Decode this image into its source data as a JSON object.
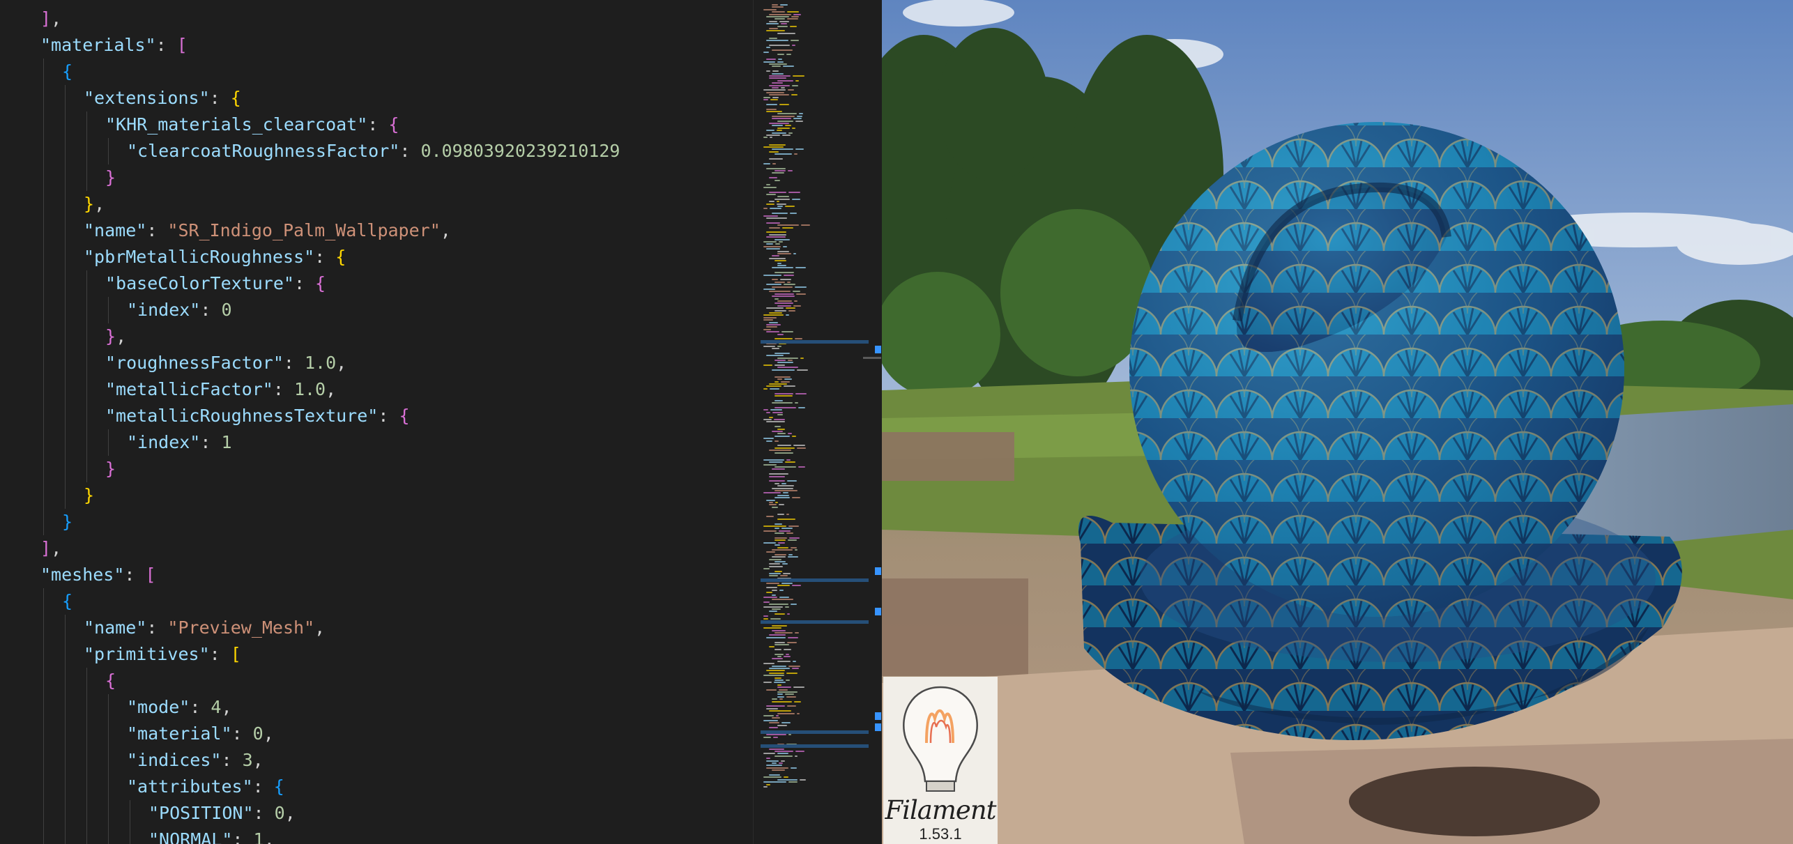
{
  "editor": {
    "lines": [
      {
        "indent": 1,
        "tokens": [
          {
            "t": "]",
            "c": "b1"
          },
          {
            "t": ",",
            "c": "p"
          }
        ]
      },
      {
        "indent": 1,
        "tokens": [
          {
            "t": "\"materials\"",
            "c": "k"
          },
          {
            "t": ": ",
            "c": "p"
          },
          {
            "t": "[",
            "c": "b1"
          }
        ]
      },
      {
        "indent": 2,
        "tokens": [
          {
            "t": "{",
            "c": "b2"
          }
        ]
      },
      {
        "indent": 3,
        "tokens": [
          {
            "t": "\"extensions\"",
            "c": "k"
          },
          {
            "t": ": ",
            "c": "p"
          },
          {
            "t": "{",
            "c": "b0"
          }
        ]
      },
      {
        "indent": 4,
        "tokens": [
          {
            "t": "\"KHR_materials_clearcoat\"",
            "c": "k"
          },
          {
            "t": ": ",
            "c": "p"
          },
          {
            "t": "{",
            "c": "b1"
          }
        ]
      },
      {
        "indent": 5,
        "tokens": [
          {
            "t": "\"clearcoatRoughnessFactor\"",
            "c": "k"
          },
          {
            "t": ": ",
            "c": "p"
          },
          {
            "t": "0.09803920239210129",
            "c": "n"
          }
        ]
      },
      {
        "indent": 4,
        "tokens": [
          {
            "t": "}",
            "c": "b1"
          }
        ]
      },
      {
        "indent": 3,
        "tokens": [
          {
            "t": "}",
            "c": "b0"
          },
          {
            "t": ",",
            "c": "p"
          }
        ]
      },
      {
        "indent": 3,
        "tokens": [
          {
            "t": "\"name\"",
            "c": "k"
          },
          {
            "t": ": ",
            "c": "p"
          },
          {
            "t": "\"SR_Indigo_Palm_Wallpaper\"",
            "c": "s"
          },
          {
            "t": ",",
            "c": "p"
          }
        ]
      },
      {
        "indent": 3,
        "tokens": [
          {
            "t": "\"pbrMetallicRoughness\"",
            "c": "k"
          },
          {
            "t": ": ",
            "c": "p"
          },
          {
            "t": "{",
            "c": "b0"
          }
        ]
      },
      {
        "indent": 4,
        "tokens": [
          {
            "t": "\"baseColorTexture\"",
            "c": "k"
          },
          {
            "t": ": ",
            "c": "p"
          },
          {
            "t": "{",
            "c": "b1"
          }
        ]
      },
      {
        "indent": 5,
        "tokens": [
          {
            "t": "\"index\"",
            "c": "k"
          },
          {
            "t": ": ",
            "c": "p"
          },
          {
            "t": "0",
            "c": "n"
          }
        ]
      },
      {
        "indent": 4,
        "tokens": [
          {
            "t": "}",
            "c": "b1"
          },
          {
            "t": ",",
            "c": "p"
          }
        ]
      },
      {
        "indent": 4,
        "tokens": [
          {
            "t": "\"roughnessFactor\"",
            "c": "k"
          },
          {
            "t": ": ",
            "c": "p"
          },
          {
            "t": "1.0",
            "c": "n"
          },
          {
            "t": ",",
            "c": "p"
          }
        ]
      },
      {
        "indent": 4,
        "tokens": [
          {
            "t": "\"metallicFactor\"",
            "c": "k"
          },
          {
            "t": ": ",
            "c": "p"
          },
          {
            "t": "1.0",
            "c": "n"
          },
          {
            "t": ",",
            "c": "p"
          }
        ]
      },
      {
        "indent": 4,
        "tokens": [
          {
            "t": "\"metallicRoughnessTexture\"",
            "c": "k"
          },
          {
            "t": ": ",
            "c": "p"
          },
          {
            "t": "{",
            "c": "b1"
          }
        ]
      },
      {
        "indent": 5,
        "tokens": [
          {
            "t": "\"index\"",
            "c": "k"
          },
          {
            "t": ": ",
            "c": "p"
          },
          {
            "t": "1",
            "c": "n"
          }
        ]
      },
      {
        "indent": 4,
        "tokens": [
          {
            "t": "}",
            "c": "b1"
          }
        ]
      },
      {
        "indent": 3,
        "tokens": [
          {
            "t": "}",
            "c": "b0"
          }
        ]
      },
      {
        "indent": 2,
        "tokens": [
          {
            "t": "}",
            "c": "b2"
          }
        ]
      },
      {
        "indent": 1,
        "tokens": [
          {
            "t": "]",
            "c": "b1"
          },
          {
            "t": ",",
            "c": "p"
          }
        ]
      },
      {
        "indent": 1,
        "tokens": [
          {
            "t": "\"meshes\"",
            "c": "k"
          },
          {
            "t": ": ",
            "c": "p"
          },
          {
            "t": "[",
            "c": "b1"
          }
        ]
      },
      {
        "indent": 2,
        "tokens": [
          {
            "t": "{",
            "c": "b2"
          }
        ]
      },
      {
        "indent": 3,
        "tokens": [
          {
            "t": "\"name\"",
            "c": "k"
          },
          {
            "t": ": ",
            "c": "p"
          },
          {
            "t": "\"Preview_Mesh\"",
            "c": "s"
          },
          {
            "t": ",",
            "c": "p"
          }
        ]
      },
      {
        "indent": 3,
        "tokens": [
          {
            "t": "\"primitives\"",
            "c": "k"
          },
          {
            "t": ": ",
            "c": "p"
          },
          {
            "t": "[",
            "c": "b0"
          }
        ]
      },
      {
        "indent": 4,
        "tokens": [
          {
            "t": "{",
            "c": "b1"
          }
        ]
      },
      {
        "indent": 5,
        "tokens": [
          {
            "t": "\"mode\"",
            "c": "k"
          },
          {
            "t": ": ",
            "c": "p"
          },
          {
            "t": "4",
            "c": "n"
          },
          {
            "t": ",",
            "c": "p"
          }
        ]
      },
      {
        "indent": 5,
        "tokens": [
          {
            "t": "\"material\"",
            "c": "k"
          },
          {
            "t": ": ",
            "c": "p"
          },
          {
            "t": "0",
            "c": "n"
          },
          {
            "t": ",",
            "c": "p"
          }
        ]
      },
      {
        "indent": 5,
        "tokens": [
          {
            "t": "\"indices\"",
            "c": "k"
          },
          {
            "t": ": ",
            "c": "p"
          },
          {
            "t": "3",
            "c": "n"
          },
          {
            "t": ",",
            "c": "p"
          }
        ]
      },
      {
        "indent": 5,
        "tokens": [
          {
            "t": "\"attributes\"",
            "c": "k"
          },
          {
            "t": ": ",
            "c": "p"
          },
          {
            "t": "{",
            "c": "b2"
          }
        ]
      },
      {
        "indent": 6,
        "tokens": [
          {
            "t": "\"POSITION\"",
            "c": "k"
          },
          {
            "t": ": ",
            "c": "p"
          },
          {
            "t": "0",
            "c": "n"
          },
          {
            "t": ",",
            "c": "p"
          }
        ]
      },
      {
        "indent": 6,
        "tokens": [
          {
            "t": "\"NORMAL\"",
            "c": "k"
          },
          {
            "t": ": ",
            "c": "p"
          },
          {
            "t": "1",
            "c": "n"
          },
          {
            "t": ",",
            "c": "p"
          }
        ]
      }
    ]
  },
  "viewer": {
    "logo_word": "Filament",
    "version": "1.53.1"
  },
  "colors": {
    "editor_bg": "#1e1e1e",
    "key": "#9cdcfe",
    "string": "#ce9178",
    "number": "#b5cea8",
    "bracket_gold": "#ffd700",
    "bracket_orchid": "#da70d6",
    "bracket_blue": "#179fff",
    "scroll_marker": "#3794ff"
  }
}
